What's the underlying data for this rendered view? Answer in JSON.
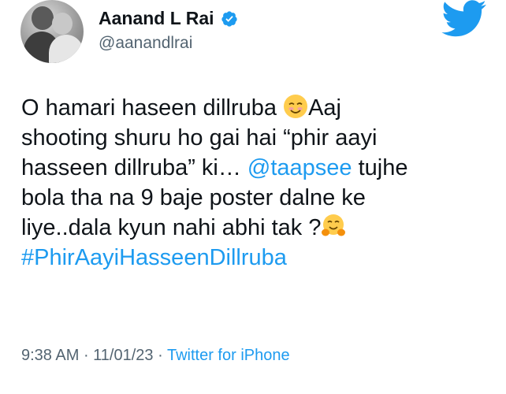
{
  "author": {
    "name": "Aanand L Rai",
    "handle": "@aanandlrai",
    "verified_icon": "verified-badge-icon",
    "avatar_icon": "avatar-photo"
  },
  "brand": {
    "icon": "twitter-bird-icon",
    "color": "#1d9bf0"
  },
  "tweet": {
    "line1_text": "O hamari haseen dillruba ",
    "line1_emoji": "smiling-face-emoji",
    "line1_after": "Aaj",
    "line2": "shooting shuru ho gai hai “phir aayi",
    "line3_text": "hasseen dillruba” ki… ",
    "mention": "@taapsee",
    "line3_after": " tujhe",
    "line4": "bola tha na 9 baje  poster dalne ke",
    "line5_text": "liye..dala kyun nahi abhi tak ?",
    "line5_emoji": "hugging-face-emoji",
    "hashtag": "#PhirAayiHasseenDillruba"
  },
  "meta": {
    "time": "9:38 AM",
    "sep1": " · ",
    "date": "11/01/23",
    "sep2": " · ",
    "source": "Twitter for iPhone"
  },
  "colors": {
    "text": "#0f1419",
    "secondary": "#536471",
    "link": "#1d9bf0"
  }
}
